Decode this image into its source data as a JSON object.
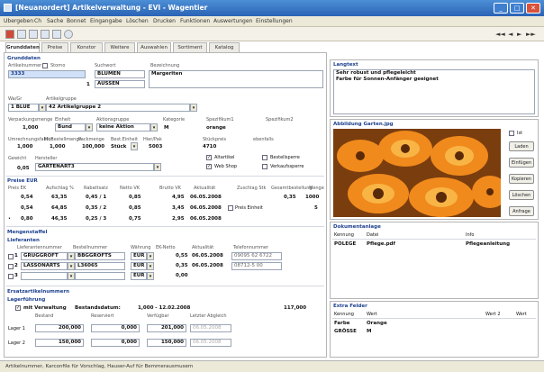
{
  "window": {
    "title": "[Neuanordert] Artikelverwaltung - EVI - Wagentier"
  },
  "menu": [
    "Ubergeben",
    "Ch",
    "Sache",
    "Bonnet",
    "Eingangabe",
    "Löschen",
    "Drucken",
    "Funktionen",
    "Auswertungen",
    "Einstellungen"
  ],
  "tabs": [
    "Grunddaten",
    "Preise",
    "Konstor",
    "Weitere",
    "Auswahlen",
    "Sortiment",
    "Katalog"
  ],
  "sections": {
    "grunddaten": "Grunddaten",
    "preise": "Preise EUR",
    "mengenstaffel": "Mengenstaffel",
    "lieferanten": "Lieferanten",
    "ersatzartikel": "Ersatzartikelnummern",
    "lagerfuehrung": "Lagerführung"
  },
  "grund": {
    "artikelnummer_label": "Artikelnummer",
    "storno_label": "Storno",
    "suchwort_label": "Suchwort",
    "bezeichnung_label": "Bezeichnung",
    "artikelnummer": "3333",
    "suchwort1": "BLUMEN",
    "suchwort2": "AUSSEN",
    "suchwort2_index": "1",
    "bezeichnung": "Margeriten",
    "warengruppe_label": "Wa/Gr",
    "artikelgruppe_label": "Artikelgruppe",
    "warengruppe": "1 BLUE",
    "artikelgruppe": "42 Artikelgruppe 2",
    "verpackung_label": "Verpackungsmenge",
    "einheit_label": "Einheit",
    "aktionsgruppe_label": "Aktionsgruppe",
    "kategorie_label": "Kategorie",
    "speziell1_label": "Spezifikum1",
    "speziell2_label": "Spezifikum2",
    "verpackung": "1,000",
    "einheit": "Bund",
    "aktionsgruppe": "keine Aktion",
    "kategorie": "M",
    "speziell1": "orange",
    "speziell2": "",
    "umrechnung_label": "Umrechnungsfaktor",
    "bestellmenge_label": "Mi.Bestellmenge",
    "packmenge_label": "Packmenge",
    "bestelleinheit_label": "Best.Einheit",
    "ean_label": "Hier/Pak",
    "stueckpreis_label": "Stückpreis",
    "ebenfalls_label": "ebenfalls",
    "umrechnung": "1,000",
    "bestellmenge": "1,000",
    "packmenge": "100,000",
    "bestelleinheit": "Stück",
    "ean": "5003",
    "stueckpreis": "4710",
    "gewicht_label": "Gewicht",
    "hersteller_label": "Hersteller",
    "gewicht": "0,05",
    "hersteller": "GÄRTENART3",
    "checks": [
      {
        "label": "Altartikel",
        "checked": true
      },
      {
        "label": "Web Shop",
        "checked": true
      },
      {
        "label": "Bestellsperre",
        "checked": false
      },
      {
        "label": "Verkaufssperre",
        "checked": false
      }
    ]
  },
  "preise": {
    "headers": [
      "Preis EK",
      "Aufschlag %",
      "Rabattsatz",
      "Netto VK",
      "Brutto VK",
      "Aktualität",
      "Zuschlag Stk",
      "Gesamtbestellung",
      "Menge"
    ],
    "rows": [
      [
        "0,54",
        "63,35",
        "0,45 / 1",
        "0,85",
        "4,95",
        "06.05.2008",
        "0,35",
        "1000"
      ],
      [
        "0,54",
        "64,85",
        "0,35 / 2",
        "0,85",
        "3,45",
        "06.05.2008",
        "",
        "5"
      ],
      [
        "0,80",
        "46,35",
        "0,25 / 3",
        "0,75",
        "2,95",
        "06.05.2008",
        "",
        ""
      ]
    ],
    "price_field_label": "Preis Einheit"
  },
  "lieferanten": {
    "headers": [
      "Lieferantennummer",
      "Bestellnummer",
      "Währung",
      "EK-Netto",
      "Aktualität",
      "Telefonnummer"
    ],
    "rows": [
      [
        "1",
        "GRÜGGROFT",
        "BBGGROFTS",
        "EUR",
        "0,55",
        "06.05.2008",
        "09095 62 6722"
      ],
      [
        "2",
        "LASSONARTS",
        "L36065",
        "EUR",
        "0,35",
        "06.05.2008",
        "08712-5 00"
      ],
      [
        "3",
        "",
        "",
        "EUR",
        "0,00",
        "",
        ""
      ]
    ]
  },
  "lager": {
    "mit_label": "mit Verwaltung",
    "bestandsdatum_label": "Bestandsdatum:",
    "bestandsdatum": "1,000 - 12.02.2008",
    "summe": "117,000",
    "headers": [
      "Bestand",
      "Reserviert",
      "Verfügbar",
      "Letzter Abgleich"
    ],
    "rows": [
      {
        "name": "Lager 1",
        "bestand": "200,000",
        "reserviert": "0,000",
        "verfuegbar": "201,000",
        "datum": "06.05.2008"
      },
      {
        "name": "Lager 2",
        "bestand": "150,000",
        "reserviert": "0,000",
        "verfuegbar": "150,000",
        "datum": "06.05.2008"
      }
    ]
  },
  "langtext": {
    "header": "Langtext",
    "line1": "Sehr robust und pflegeleicht",
    "line2": "Farbe für Sonnen-Anfänger geeignet"
  },
  "bild": {
    "header": "Abbildung Garten.jpg",
    "check_label": "Ist",
    "buttons": [
      "Laden",
      "Einfügen",
      "Kopieren",
      "Löschen",
      "Anfrage"
    ]
  },
  "dokumente": {
    "header": "Dokumentanlage",
    "headers": [
      "Kennung",
      "Datei",
      "Info"
    ],
    "rows": [
      [
        "POLEGE",
        "Pflege.pdf",
        "Pflegeanleitung"
      ]
    ]
  },
  "extrafelder": {
    "header": "Extra Felder",
    "headers": [
      "Kennung",
      "Wert",
      "Wert 2",
      "Wert"
    ],
    "rows": [
      [
        "Farbe",
        "Orange",
        "",
        ""
      ],
      [
        "GRÖSSE",
        "M",
        "",
        ""
      ]
    ]
  },
  "statusbar": {
    "text": "Artikelnummer, Karconfile für Vorschlag, Hauser-Auf für Bemmerausmusern"
  },
  "colors": {
    "titlebar": "#2a63b5",
    "accent": "#1c3f8f",
    "selection": "#cfe0f8"
  }
}
